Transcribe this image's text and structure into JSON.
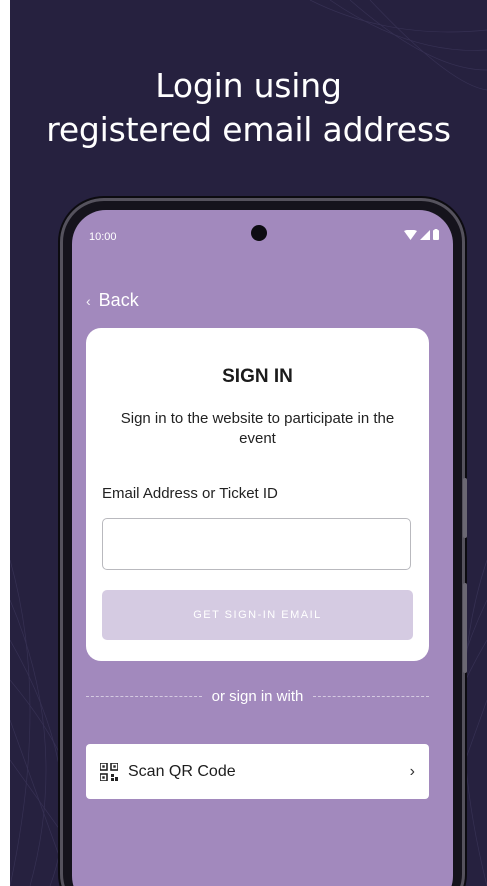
{
  "headline": {
    "line1": "Login using",
    "line2": "registered email address"
  },
  "status_bar": {
    "time": "10:00",
    "icons": [
      "wifi-icon",
      "signal-icon",
      "battery-icon"
    ]
  },
  "nav": {
    "back_label": "Back",
    "back_icon": "chevron-left-icon"
  },
  "signin_card": {
    "title": "SIGN IN",
    "subtitle": "Sign in to the website to participate in the event",
    "field_label": "Email Address or Ticket ID",
    "field_value": "",
    "button_label": "GET SIGN-IN EMAIL"
  },
  "alt_signin": {
    "divider_text": "or sign in with",
    "qr_label": "Scan QR Code",
    "qr_icon": "qr-code-icon",
    "chevron_icon": "chevron-right-icon"
  },
  "colors": {
    "background": "#26213f",
    "screen": "#a289bd",
    "button_disabled": "#d5cbe2",
    "card": "#ffffff"
  }
}
